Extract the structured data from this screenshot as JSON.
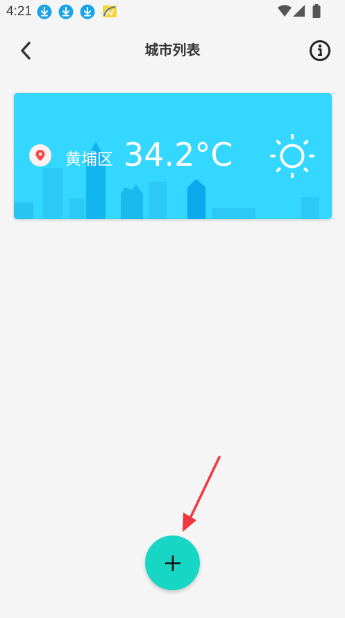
{
  "status_bar": {
    "time": "4:21",
    "icons": [
      "download-icon",
      "download-icon",
      "download-icon",
      "notification-app-icon",
      "wifi-icon",
      "signal-icon",
      "battery-icon"
    ]
  },
  "header": {
    "title": "城市列表",
    "back_icon": "chevron-left-icon",
    "info_icon": "info-icon"
  },
  "city_card": {
    "city_name": "黄埔区",
    "temperature": "34.2°C",
    "location_icon": "location-pin-icon",
    "weather_icon": "sun-icon",
    "background_color": "#33d7ff"
  },
  "fab": {
    "icon": "plus-icon",
    "color": "#18d6c4"
  },
  "annotation": {
    "icon": "red-arrow",
    "color": "#f0363e"
  }
}
